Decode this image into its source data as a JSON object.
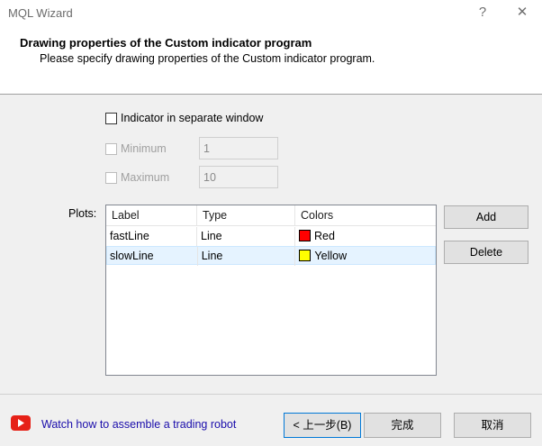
{
  "window": {
    "title": "MQL Wizard",
    "help_glyph": "?",
    "close_glyph": "✕"
  },
  "header": {
    "title": "Drawing properties of the Custom indicator program",
    "subtitle": "Please specify drawing properties of the Custom indicator program."
  },
  "options": {
    "separate_window": {
      "label": "Indicator in separate window",
      "checked": false
    },
    "minimum": {
      "label": "Minimum",
      "value": "1",
      "enabled": false
    },
    "maximum": {
      "label": "Maximum",
      "value": "10",
      "enabled": false
    }
  },
  "plots": {
    "label": "Plots:",
    "columns": [
      "Label",
      "Type",
      "Colors"
    ],
    "rows": [
      {
        "label": "fastLine",
        "type": "Line",
        "color_name": "Red",
        "color": "#ff0000",
        "selected": false
      },
      {
        "label": "slowLine",
        "type": "Line",
        "color_name": "Yellow",
        "color": "#ffff00",
        "selected": true
      }
    ],
    "add_label": "Add",
    "delete_label": "Delete"
  },
  "footer": {
    "video_link": "Watch how to assemble a trading robot",
    "back_label": "< 上一步(B)",
    "finish_label": "完成",
    "cancel_label": "取消"
  },
  "icons": {
    "help": "help-icon",
    "close": "close-icon",
    "youtube": "youtube-play-icon"
  },
  "colors": {
    "link": "#1a0dab",
    "selection": "#e5f3ff",
    "youtube_red": "#e62117"
  }
}
